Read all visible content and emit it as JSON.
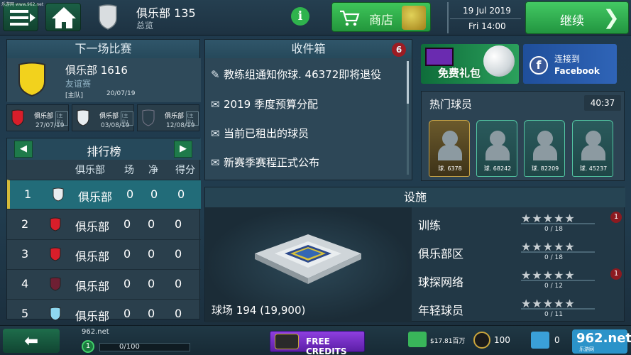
{
  "watermark": "乐游网 www.962.net",
  "topbar": {
    "club_name": "俱乐部 135",
    "club_sub": "总览",
    "shop_label": "商店",
    "date": "19 Jul 2019",
    "day_time": "Fri 14:00",
    "continue_label": "继续"
  },
  "next_match": {
    "title": "下一场比赛",
    "opponent": "俱乐部 1616",
    "type": "友谊赛",
    "tag": "[主队]",
    "date": "20/07/19",
    "fixtures": [
      {
        "name": "俱乐部",
        "tag": "[主队]",
        "date": "27/07/19",
        "color": "#d81e2a"
      },
      {
        "name": "俱乐部",
        "tag": "[主队]",
        "date": "03/08/19",
        "color": "#e8ecef"
      },
      {
        "name": "俱乐部",
        "tag": "[主队]",
        "date": "12/08/19",
        "color": "#2a3e4a"
      }
    ]
  },
  "league": {
    "title": "排行榜",
    "col_club": "俱乐部",
    "col_played": "场",
    "col_net": "净",
    "col_points": "得分",
    "rows": [
      {
        "pos": "1",
        "club": "俱乐部",
        "p": "0",
        "gd": "0",
        "pts": "0",
        "color": "#e8ecef"
      },
      {
        "pos": "2",
        "club": "俱乐部",
        "p": "0",
        "gd": "0",
        "pts": "0",
        "color": "#d81e2a"
      },
      {
        "pos": "3",
        "club": "俱乐部",
        "p": "0",
        "gd": "0",
        "pts": "0",
        "color": "#d81e2a"
      },
      {
        "pos": "4",
        "club": "俱乐部",
        "p": "0",
        "gd": "0",
        "pts": "0",
        "color": "#6e1f33"
      },
      {
        "pos": "5",
        "club": "俱乐部",
        "p": "0",
        "gd": "0",
        "pts": "0",
        "color": "#8ed8f0"
      }
    ]
  },
  "inbox": {
    "title": "收件箱",
    "count": "6",
    "messages": [
      {
        "icon": "document",
        "text": "教练组通知你球. 46372即将退役"
      },
      {
        "icon": "envelope",
        "text": "2019 季度预算分配"
      },
      {
        "icon": "envelope",
        "text": "当前已租出的球员"
      },
      {
        "icon": "envelope",
        "text": "新赛季赛程正式公布"
      }
    ]
  },
  "promo": {
    "gift_label": "免费礼包",
    "fb_line1": "连接到",
    "fb_line2": "Facebook"
  },
  "hot_players": {
    "title": "热门球员",
    "timer": "40:37",
    "players": [
      {
        "label": "球. 6378"
      },
      {
        "label": "球. 68242"
      },
      {
        "label": "球. 82209"
      },
      {
        "label": "球. 45237"
      }
    ]
  },
  "facilities": {
    "title": "设施",
    "stadium_label": "球场 194 (19,900)",
    "items": [
      {
        "name": "训练",
        "level": "0 / 18",
        "stars": 0,
        "alert": "1"
      },
      {
        "name": "俱乐部区",
        "level": "0 / 18",
        "stars": 0,
        "alert": ""
      },
      {
        "name": "球探网络",
        "level": "0 / 12",
        "stars": 0,
        "alert": "1"
      },
      {
        "name": "年轻球员",
        "level": "0 / 11",
        "stars": 0,
        "alert": ""
      }
    ]
  },
  "bottom": {
    "site": "962.net",
    "level": "1",
    "xp": "0/100",
    "credits_label": "FREE CREDITS",
    "money": "$17.81百万",
    "tokens": "100",
    "gifts": "0",
    "logo_big": "962.net",
    "logo_small": "乐游网"
  },
  "colors": {
    "accent_green": "#2fb34d",
    "alert_red": "#9b1c23",
    "selected_row": "#226c79"
  }
}
